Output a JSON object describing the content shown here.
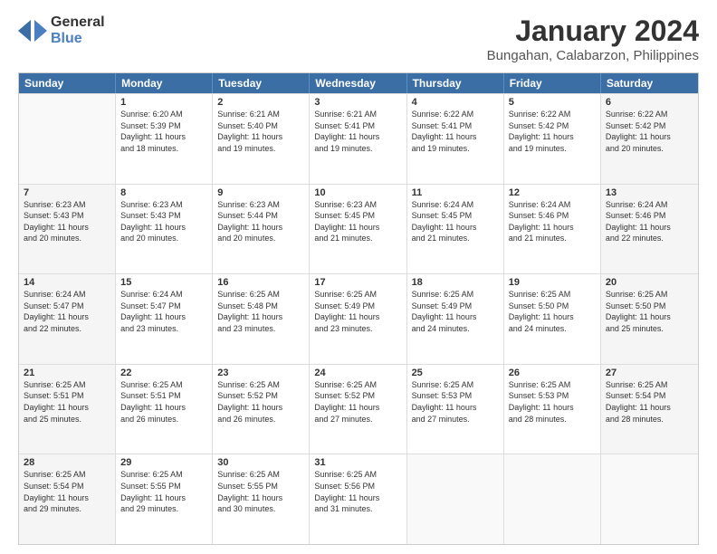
{
  "logo": {
    "general": "General",
    "blue": "Blue"
  },
  "title": "January 2024",
  "subtitle": "Bungahan, Calabarzon, Philippines",
  "header_days": [
    "Sunday",
    "Monday",
    "Tuesday",
    "Wednesday",
    "Thursday",
    "Friday",
    "Saturday"
  ],
  "weeks": [
    [
      {
        "day": "",
        "detail": "",
        "empty": true
      },
      {
        "day": "1",
        "detail": "Sunrise: 6:20 AM\nSunset: 5:39 PM\nDaylight: 11 hours\nand 18 minutes.",
        "empty": false
      },
      {
        "day": "2",
        "detail": "Sunrise: 6:21 AM\nSunset: 5:40 PM\nDaylight: 11 hours\nand 19 minutes.",
        "empty": false
      },
      {
        "day": "3",
        "detail": "Sunrise: 6:21 AM\nSunset: 5:41 PM\nDaylight: 11 hours\nand 19 minutes.",
        "empty": false
      },
      {
        "day": "4",
        "detail": "Sunrise: 6:22 AM\nSunset: 5:41 PM\nDaylight: 11 hours\nand 19 minutes.",
        "empty": false
      },
      {
        "day": "5",
        "detail": "Sunrise: 6:22 AM\nSunset: 5:42 PM\nDaylight: 11 hours\nand 19 minutes.",
        "empty": false
      },
      {
        "day": "6",
        "detail": "Sunrise: 6:22 AM\nSunset: 5:42 PM\nDaylight: 11 hours\nand 20 minutes.",
        "empty": false
      }
    ],
    [
      {
        "day": "7",
        "detail": "Sunrise: 6:23 AM\nSunset: 5:43 PM\nDaylight: 11 hours\nand 20 minutes.",
        "empty": false
      },
      {
        "day": "8",
        "detail": "Sunrise: 6:23 AM\nSunset: 5:43 PM\nDaylight: 11 hours\nand 20 minutes.",
        "empty": false
      },
      {
        "day": "9",
        "detail": "Sunrise: 6:23 AM\nSunset: 5:44 PM\nDaylight: 11 hours\nand 20 minutes.",
        "empty": false
      },
      {
        "day": "10",
        "detail": "Sunrise: 6:23 AM\nSunset: 5:45 PM\nDaylight: 11 hours\nand 21 minutes.",
        "empty": false
      },
      {
        "day": "11",
        "detail": "Sunrise: 6:24 AM\nSunset: 5:45 PM\nDaylight: 11 hours\nand 21 minutes.",
        "empty": false
      },
      {
        "day": "12",
        "detail": "Sunrise: 6:24 AM\nSunset: 5:46 PM\nDaylight: 11 hours\nand 21 minutes.",
        "empty": false
      },
      {
        "day": "13",
        "detail": "Sunrise: 6:24 AM\nSunset: 5:46 PM\nDaylight: 11 hours\nand 22 minutes.",
        "empty": false
      }
    ],
    [
      {
        "day": "14",
        "detail": "Sunrise: 6:24 AM\nSunset: 5:47 PM\nDaylight: 11 hours\nand 22 minutes.",
        "empty": false
      },
      {
        "day": "15",
        "detail": "Sunrise: 6:24 AM\nSunset: 5:47 PM\nDaylight: 11 hours\nand 23 minutes.",
        "empty": false
      },
      {
        "day": "16",
        "detail": "Sunrise: 6:25 AM\nSunset: 5:48 PM\nDaylight: 11 hours\nand 23 minutes.",
        "empty": false
      },
      {
        "day": "17",
        "detail": "Sunrise: 6:25 AM\nSunset: 5:49 PM\nDaylight: 11 hours\nand 23 minutes.",
        "empty": false
      },
      {
        "day": "18",
        "detail": "Sunrise: 6:25 AM\nSunset: 5:49 PM\nDaylight: 11 hours\nand 24 minutes.",
        "empty": false
      },
      {
        "day": "19",
        "detail": "Sunrise: 6:25 AM\nSunset: 5:50 PM\nDaylight: 11 hours\nand 24 minutes.",
        "empty": false
      },
      {
        "day": "20",
        "detail": "Sunrise: 6:25 AM\nSunset: 5:50 PM\nDaylight: 11 hours\nand 25 minutes.",
        "empty": false
      }
    ],
    [
      {
        "day": "21",
        "detail": "Sunrise: 6:25 AM\nSunset: 5:51 PM\nDaylight: 11 hours\nand 25 minutes.",
        "empty": false
      },
      {
        "day": "22",
        "detail": "Sunrise: 6:25 AM\nSunset: 5:51 PM\nDaylight: 11 hours\nand 26 minutes.",
        "empty": false
      },
      {
        "day": "23",
        "detail": "Sunrise: 6:25 AM\nSunset: 5:52 PM\nDaylight: 11 hours\nand 26 minutes.",
        "empty": false
      },
      {
        "day": "24",
        "detail": "Sunrise: 6:25 AM\nSunset: 5:52 PM\nDaylight: 11 hours\nand 27 minutes.",
        "empty": false
      },
      {
        "day": "25",
        "detail": "Sunrise: 6:25 AM\nSunset: 5:53 PM\nDaylight: 11 hours\nand 27 minutes.",
        "empty": false
      },
      {
        "day": "26",
        "detail": "Sunrise: 6:25 AM\nSunset: 5:53 PM\nDaylight: 11 hours\nand 28 minutes.",
        "empty": false
      },
      {
        "day": "27",
        "detail": "Sunrise: 6:25 AM\nSunset: 5:54 PM\nDaylight: 11 hours\nand 28 minutes.",
        "empty": false
      }
    ],
    [
      {
        "day": "28",
        "detail": "Sunrise: 6:25 AM\nSunset: 5:54 PM\nDaylight: 11 hours\nand 29 minutes.",
        "empty": false
      },
      {
        "day": "29",
        "detail": "Sunrise: 6:25 AM\nSunset: 5:55 PM\nDaylight: 11 hours\nand 29 minutes.",
        "empty": false
      },
      {
        "day": "30",
        "detail": "Sunrise: 6:25 AM\nSunset: 5:55 PM\nDaylight: 11 hours\nand 30 minutes.",
        "empty": false
      },
      {
        "day": "31",
        "detail": "Sunrise: 6:25 AM\nSunset: 5:56 PM\nDaylight: 11 hours\nand 31 minutes.",
        "empty": false
      },
      {
        "day": "",
        "detail": "",
        "empty": true
      },
      {
        "day": "",
        "detail": "",
        "empty": true
      },
      {
        "day": "",
        "detail": "",
        "empty": true
      }
    ]
  ]
}
